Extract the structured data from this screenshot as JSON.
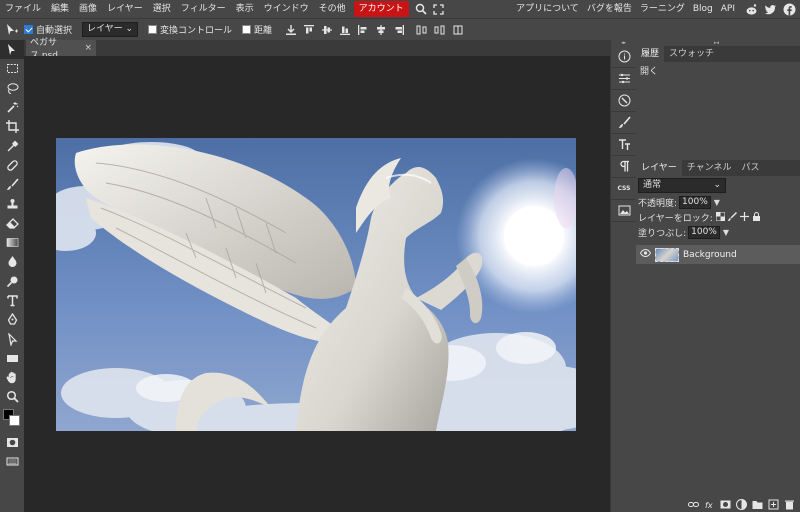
{
  "menubar": {
    "items": [
      "ファイル",
      "編集",
      "画像",
      "レイヤー",
      "選択",
      "フィルター",
      "表示",
      "ウインドウ",
      "その他"
    ],
    "account_label": "アカウント",
    "right_items": [
      "アプリについて",
      "バグを報告",
      "ラーニング",
      "Blog",
      "API"
    ],
    "social_icons": [
      "reddit-icon",
      "twitter-icon",
      "facebook-icon"
    ]
  },
  "options": {
    "auto_select_label": "自動選択",
    "auto_select_checked": true,
    "target_value": "レイヤー",
    "transform_controls_label": "変換コントロール",
    "transform_controls_checked": false,
    "distance_label": "距離",
    "distance_checked": false
  },
  "toolbar": {
    "tools": [
      "move-tool",
      "marquee-tool",
      "lasso-tool",
      "magic-wand-tool",
      "crop-tool",
      "eyedropper-tool",
      "healing-tool",
      "brush-tool",
      "clone-stamp-tool",
      "eraser-tool",
      "gradient-tool",
      "blur-tool",
      "dodge-tool",
      "type-tool",
      "pen-tool",
      "path-select-tool",
      "rectangle-tool",
      "hand-tool",
      "zoom-tool"
    ],
    "foreground_color": "#000000",
    "background_color": "#ffffff"
  },
  "document": {
    "tab_name": "ペガサス.psd",
    "close_glyph": "×"
  },
  "strip": {
    "icons": [
      "info-icon",
      "adjustments-icon",
      "brush-settings-icon",
      "brush-icon",
      "character-icon",
      "paragraph-icon",
      "css-icon",
      "image-icon"
    ],
    "css_label": "CSS"
  },
  "history_panel": {
    "tabs": [
      "履歴",
      "スウォッチ"
    ],
    "items": [
      "開く"
    ]
  },
  "layers_panel": {
    "tabs": [
      "レイヤー",
      "チャンネル",
      "パス"
    ],
    "blend_mode": "通常",
    "opacity_label": "不透明度:",
    "opacity_value": "100%",
    "lock_label": "レイヤーをロック:",
    "fill_label": "塗りつぶし:",
    "fill_value": "100%",
    "layers": [
      {
        "name": "Background",
        "visible": true
      }
    ]
  },
  "colors": {
    "menubar_bg": "#474747",
    "account_bg": "#c81414",
    "workspace_bg": "#282828",
    "selected_layer_bg": "#5c5c5c"
  }
}
